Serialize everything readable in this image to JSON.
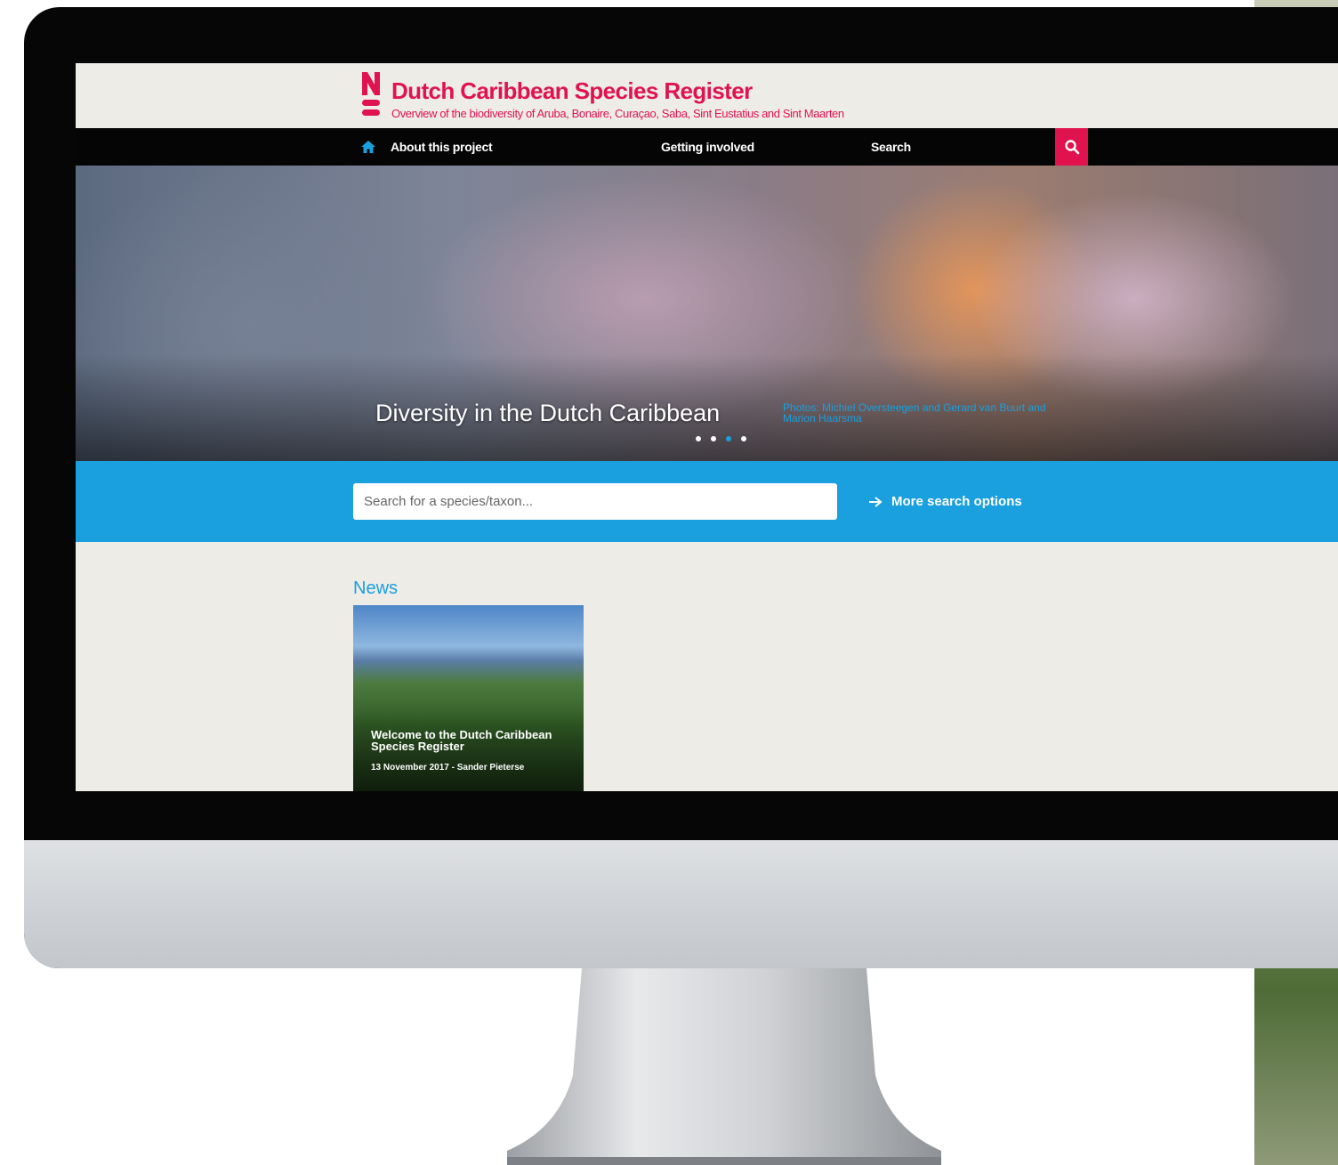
{
  "header": {
    "title": "Dutch Caribbean Species Register",
    "subtitle": "Overview of the biodiversity of Aruba, Bonaire, Curaçao, Saba, Sint Eustatius and Sint Maarten"
  },
  "nav": {
    "items": [
      {
        "label": "About this project"
      },
      {
        "label": "Getting involved"
      },
      {
        "label": "Search"
      }
    ]
  },
  "hero": {
    "title": "Diversity in the Dutch Caribbean",
    "credit": "Photos: Michiel Oversteegen and Gerard van Buurt and Marion Haarsma",
    "slide_count": 4,
    "active_slide": 3
  },
  "search": {
    "placeholder": "Search for a species/taxon...",
    "more_options_label": "More search options"
  },
  "news": {
    "heading": "News",
    "items": [
      {
        "title": "Welcome to the Dutch Caribbean Species Register",
        "meta": "13 November 2017 - Sander Pieterse"
      }
    ]
  },
  "colors": {
    "brand": "#e0134f",
    "accent": "#1a9fdf",
    "nav_bg": "#050505",
    "page_bg": "#eeece7"
  },
  "icons": {
    "home": "home-icon",
    "search": "search-icon",
    "arrow": "arrow-right-icon"
  }
}
